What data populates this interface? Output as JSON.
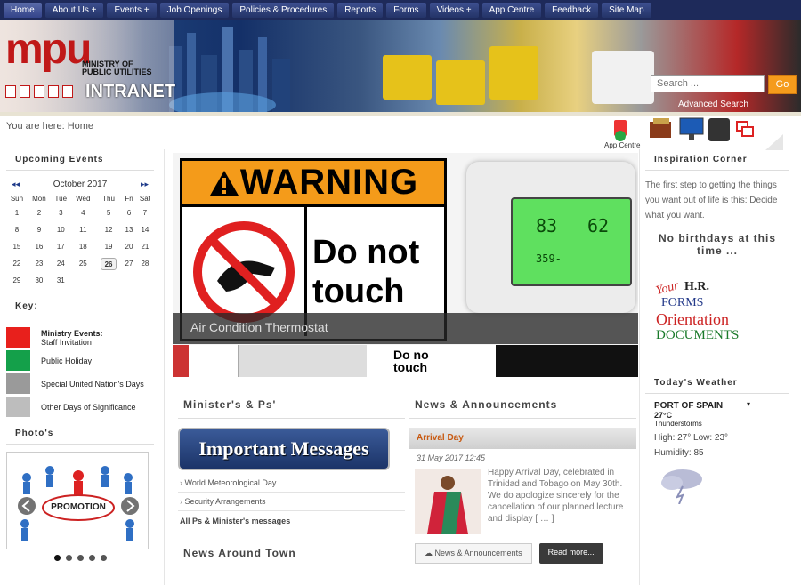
{
  "nav": {
    "items": [
      {
        "label": "Home",
        "active": true
      },
      {
        "label": "About Us +"
      },
      {
        "label": "Events +"
      },
      {
        "label": "Job Openings"
      },
      {
        "label": "Policies & Procedures"
      },
      {
        "label": "Reports"
      },
      {
        "label": "Forms"
      },
      {
        "label": "Videos +"
      },
      {
        "label": "App Centre"
      },
      {
        "label": "Feedback"
      },
      {
        "label": "Site Map"
      }
    ]
  },
  "logo": {
    "mark": "mpu",
    "line1": "MINISTRY OF",
    "line2": "PUBLIC UTILITIES",
    "line3": "INTRANET"
  },
  "search": {
    "placeholder": "Search ...",
    "button": "Go",
    "advanced": "Advanced Search"
  },
  "breadcrumb": "You are here: Home",
  "app_centre_label": "App Centre",
  "events": {
    "title": "Upcoming Events",
    "month": "October 2017",
    "weekdays": [
      "Sun",
      "Mon",
      "Tue",
      "Wed",
      "Thu",
      "Fri",
      "Sat"
    ],
    "weeks": [
      [
        "1",
        "2",
        "3",
        "4",
        "5",
        "6",
        "7"
      ],
      [
        "8",
        "9",
        "10",
        "11",
        "12",
        "13",
        "14"
      ],
      [
        "15",
        "16",
        "17",
        "18",
        "19",
        "20",
        "21"
      ],
      [
        "22",
        "23",
        "24",
        "25",
        "26",
        "27",
        "28"
      ],
      [
        "29",
        "30",
        "31",
        "",
        "",
        "",
        ""
      ]
    ],
    "today": "26"
  },
  "key": {
    "title": "Key:",
    "items": [
      {
        "color": "#e8201c",
        "label": "Ministry Events:",
        "sub": "Staff Invitation"
      },
      {
        "color": "#14a04a",
        "label": "Public Holiday",
        "sub": ""
      },
      {
        "color": "#9a9a9a",
        "label": "Special United Nation's Days",
        "sub": ""
      },
      {
        "color": "#bdbdbd",
        "label": "Other Days of Significance",
        "sub": ""
      }
    ]
  },
  "photos": {
    "title": "Photo's",
    "caption": "PROMOTION"
  },
  "slider": {
    "warning": "WARNING",
    "line1": "Do not",
    "line2": "touch",
    "caption": "Air Condition Thermostat",
    "thermo_set": "83",
    "thermo_cur": "62",
    "thermo_time": "359-",
    "thumb_text1": "Do no",
    "thumb_text2": "touch"
  },
  "ministers": {
    "title": "Minister's & Ps'",
    "banner": "Important Messages",
    "items": [
      "World Meteorological Day",
      "Security Arrangements"
    ],
    "all_link": "All Ps & Minister's messages"
  },
  "news_town": {
    "title": "News Around Town"
  },
  "news": {
    "title": "News & Announcements",
    "item_title": "Arrival Day",
    "date": "31 May 2017 12:45",
    "body": "Happy Arrival Day, celebrated in Trinidad and Tobago on May 30th.",
    "body2": "We do apologize sincerely for the cancellation of our planned lecture and display [ … ]",
    "tag": "News & Announcements",
    "read_more": "Read more..."
  },
  "inspiration": {
    "title": "Inspiration Corner",
    "text": "The first step to getting the things you want out of life is this: Decide what you want."
  },
  "birthdays": {
    "text": "No birthdays at this time ..."
  },
  "hr": {
    "your": "Your",
    "hr": "H.R.",
    "forms": "FORMS",
    "orientation": "Orientation",
    "documents": "DOCUMENTS"
  },
  "weather": {
    "title": "Today's Weather",
    "city": "PORT OF SPAIN",
    "temp": "27°C",
    "condition": "Thunderstorms",
    "highlow": "High: 27° Low: 23°",
    "humidity": "Humidity: 85"
  }
}
